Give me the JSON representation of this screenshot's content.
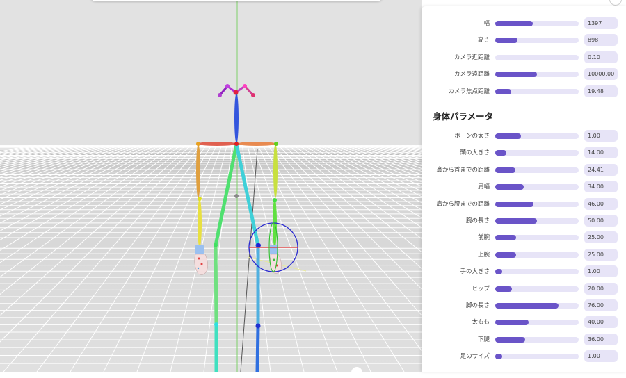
{
  "camera_settings": [
    {
      "label": "幅",
      "value": "1397",
      "level": 0.45
    },
    {
      "label": "高さ",
      "value": "898",
      "level": 0.27
    },
    {
      "label": "カメラ近距離",
      "value": "0.10",
      "level": 0.0
    },
    {
      "label": "カメラ遠距離",
      "value": "10000.00",
      "level": 0.5
    },
    {
      "label": "カメラ焦点距離",
      "value": "19.48",
      "level": 0.19
    }
  ],
  "body_params_title": "身体パラメータ",
  "body_params": [
    {
      "label": "ボーンの太さ",
      "value": "1.00",
      "level": 0.31
    },
    {
      "label": "頭の大きさ",
      "value": "14.00",
      "level": 0.13
    },
    {
      "label": "鼻から首までの距離",
      "value": "24.41",
      "level": 0.24
    },
    {
      "label": "肩幅",
      "value": "34.00",
      "level": 0.34
    },
    {
      "label": "肩から腰までの距離",
      "value": "46.00",
      "level": 0.46
    },
    {
      "label": "腕の長さ",
      "value": "50.00",
      "level": 0.5
    },
    {
      "label": "前腕",
      "value": "25.00",
      "level": 0.25
    },
    {
      "label": "上腕",
      "value": "25.00",
      "level": 0.25
    },
    {
      "label": "手の大きさ",
      "value": "1.00",
      "level": 0.08
    },
    {
      "label": "ヒップ",
      "value": "20.00",
      "level": 0.2
    },
    {
      "label": "脚の長さ",
      "value": "76.00",
      "level": 0.76
    },
    {
      "label": "太もも",
      "value": "40.00",
      "level": 0.4
    },
    {
      "label": "下腿",
      "value": "36.00",
      "level": 0.36
    },
    {
      "label": "足のサイズ",
      "value": "1.00",
      "level": 0.08
    }
  ],
  "colors": {
    "accent": "#6a54c8",
    "track": "#e7e4f7",
    "sky": "#e2e2e2",
    "floor": "#dadada"
  }
}
